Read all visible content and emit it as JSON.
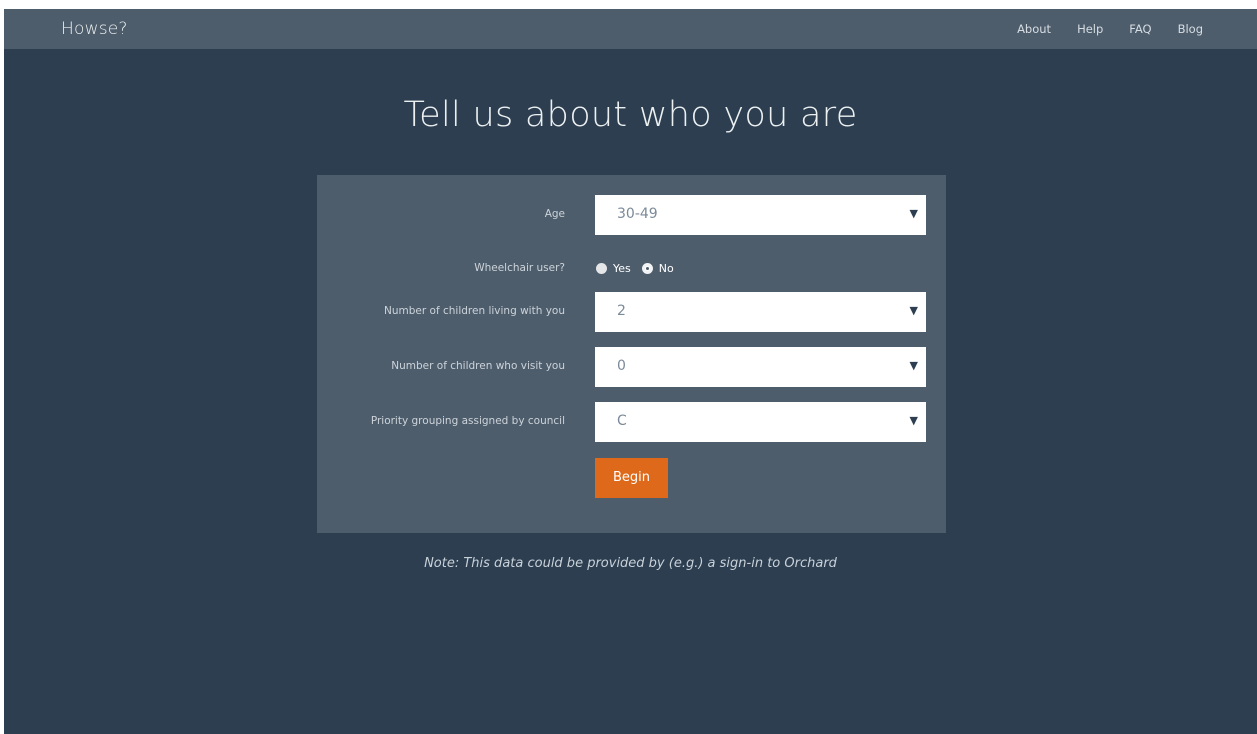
{
  "navbar": {
    "brand": "Howse?",
    "links": [
      "About",
      "Help",
      "FAQ",
      "Blog"
    ]
  },
  "page": {
    "title": "Tell us about who you are",
    "note": "Note: This data could be provided by (e.g.) a sign-in to Orchard"
  },
  "form": {
    "age": {
      "label": "Age",
      "value": "30-49"
    },
    "wheelchair": {
      "label": "Wheelchair user?",
      "options": [
        "Yes",
        "No"
      ],
      "selected": "No"
    },
    "children_living": {
      "label": "Number of children living with you",
      "value": "2"
    },
    "children_visit": {
      "label": "Number of children who visit you",
      "value": "0"
    },
    "priority": {
      "label": "Priority grouping assigned by council",
      "value": "C"
    },
    "submit_label": "Begin"
  },
  "colors": {
    "background": "#2c3e50",
    "panel": "#4e5d6c",
    "accent": "#df691a"
  },
  "icons": {
    "caret": "caret-down-icon",
    "radio": "radio-icon"
  }
}
